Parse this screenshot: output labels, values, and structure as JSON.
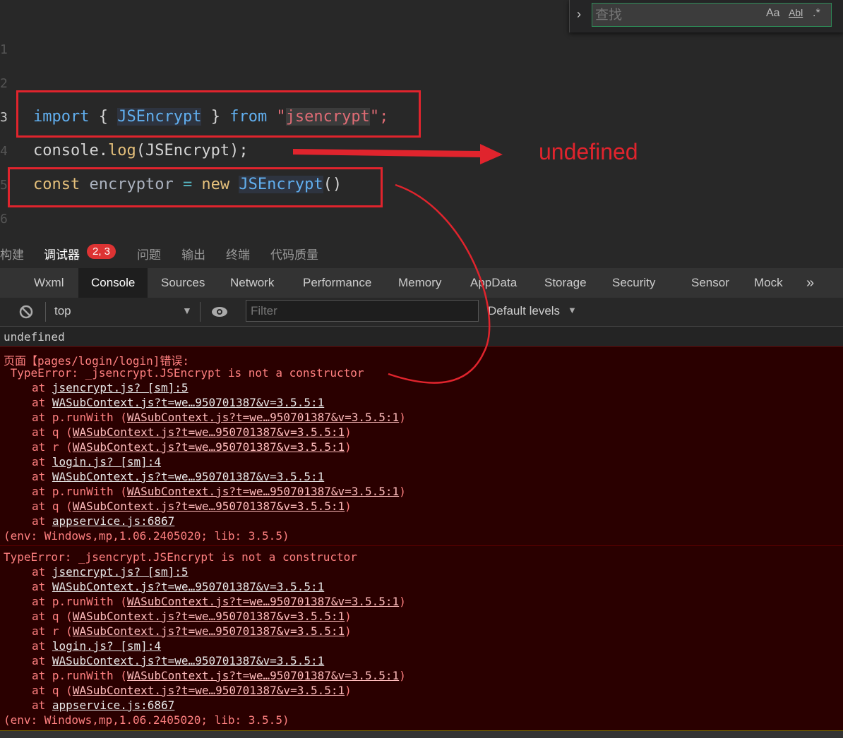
{
  "find_widget": {
    "placeholder": "查找",
    "match_case": "Aa",
    "whole_word": "Abl",
    "regex": ".*"
  },
  "editor": {
    "line_numbers": [
      "1",
      "2",
      "3",
      "4",
      "5",
      "6"
    ],
    "line3": {
      "kw": "import",
      "b1": " { ",
      "cls": "JSEncrypt",
      "b2": " } ",
      "from": "from",
      "q1": " \"",
      "str": "jsencrypt",
      "q2": "\";"
    },
    "line4": {
      "obj": "console",
      "dot": ".",
      "fn": "log",
      "args": "(JSEncrypt);"
    },
    "line5": {
      "kw": "const",
      "var": " encryptor ",
      "op": "=",
      "new": " new ",
      "cls": "JSEncrypt",
      "paren": "()"
    },
    "annotation": "undefined"
  },
  "panel_tabs": {
    "build": "构建",
    "debugger": "调试器",
    "badge": "2, 3",
    "issues": "问题",
    "output": "输出",
    "terminal": "终端",
    "code_quality": "代码质量"
  },
  "devtools_tabs": [
    "Wxml",
    "Console",
    "Sources",
    "Network",
    "Performance",
    "Memory",
    "AppData",
    "Storage",
    "Security",
    "Sensor",
    "Mock"
  ],
  "toolbar": {
    "context": "top",
    "filter_placeholder": "Filter",
    "levels": "Default levels"
  },
  "console": {
    "log_undefined": "undefined",
    "error1_header": "页面【pages/login/login]错误:",
    "error1_message": " TypeError: _jsencrypt.JSEncrypt is not a constructor",
    "error2_message": "TypeError: _jsencrypt.JSEncrypt is not a constructor",
    "frames": [
      {
        "fn": "",
        "link": "jsencrypt.js? [sm]:5",
        "paren": false
      },
      {
        "fn": "",
        "link": "WASubContext.js?t=we…950701387&v=3.5.5:1",
        "paren": false
      },
      {
        "fn": "p.runWith ",
        "link": "WASubContext.js?t=we…950701387&v=3.5.5:1",
        "paren": true
      },
      {
        "fn": "q ",
        "link": "WASubContext.js?t=we…950701387&v=3.5.5:1",
        "paren": true
      },
      {
        "fn": "r ",
        "link": "WASubContext.js?t=we…950701387&v=3.5.5:1",
        "paren": true
      },
      {
        "fn": "",
        "link": "login.js? [sm]:4",
        "paren": false
      },
      {
        "fn": "",
        "link": "WASubContext.js?t=we…950701387&v=3.5.5:1",
        "paren": false
      },
      {
        "fn": "p.runWith ",
        "link": "WASubContext.js?t=we…950701387&v=3.5.5:1",
        "paren": true
      },
      {
        "fn": "q ",
        "link": "WASubContext.js?t=we…950701387&v=3.5.5:1",
        "paren": true
      },
      {
        "fn": "",
        "link": "appservice.js:6867",
        "paren": false
      }
    ],
    "env": "(env: Windows,mp,1.06.2405020; lib: 3.5.5)"
  },
  "colors": {
    "accent_red": "#e0242d",
    "error_bg": "#2a0000",
    "error_text": "#ff8080"
  }
}
